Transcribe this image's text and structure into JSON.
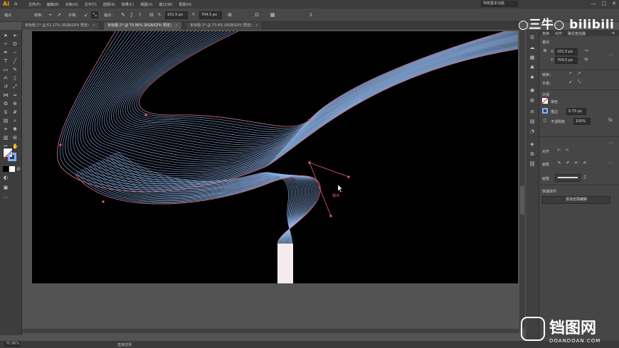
{
  "app": {
    "logo": "Ai",
    "home_icon": "home-icon",
    "menus": [
      "文件(F)",
      "编辑(E)",
      "对象(O)",
      "文字(T)",
      "选择(S)",
      "效果(C)",
      "视图(V)",
      "窗口(W)",
      "帮助(H)"
    ],
    "workspace": "传统基本功能",
    "window_buttons": [
      "—",
      "□",
      "✕"
    ]
  },
  "control_bar": {
    "left_label": "锚点",
    "convert_label": "转换：",
    "handles_label": "手柄：",
    "anchors_label": "锚点：",
    "x_label": "X:",
    "x_value": "101.5 px",
    "y_label": "Y:",
    "y_value": "704.5 px"
  },
  "tabs": [
    {
      "label": "未标题-1* @ 63.17% (RGB/GPU 预览)",
      "active": false
    },
    {
      "label": "未标题-2* @ 70.96% (RGB/GPU 预览)",
      "active": true
    },
    {
      "label": "未标题-3* @ 73.4% (RGB/GPU 预览)",
      "active": false
    }
  ],
  "panel": {
    "tabs": [
      "变换",
      "对齐",
      "路径查找器"
    ],
    "section_transform": "锚点",
    "x_label": "X:",
    "x_value": "101.5 px",
    "y_label": "Y:",
    "y_value": "704.5 px",
    "appearance_title": "外观",
    "stroke_label": "描边",
    "stroke_value": "0.75 px",
    "opacity_label": "不透明度",
    "opacity_value": "100%",
    "convert_label": "转换：",
    "handles_label": "手柄：",
    "align_label": "对齐",
    "brush_label": "画笔",
    "quick_actions": "快速操作",
    "quick_button": "添加全局编辑"
  },
  "canvas": {
    "anchor_hint": "锚点",
    "background": "#000000",
    "blend_stroke_color": "#8fb4e8",
    "path_color": "#e8607a"
  },
  "status": {
    "zoom": "70.96%",
    "tool_name": "直接选择"
  },
  "watermarks": {
    "bilibili": "○三牛○ bilibili",
    "site_cn": "铛图网",
    "site_en": "DOANDOAN.COM"
  }
}
